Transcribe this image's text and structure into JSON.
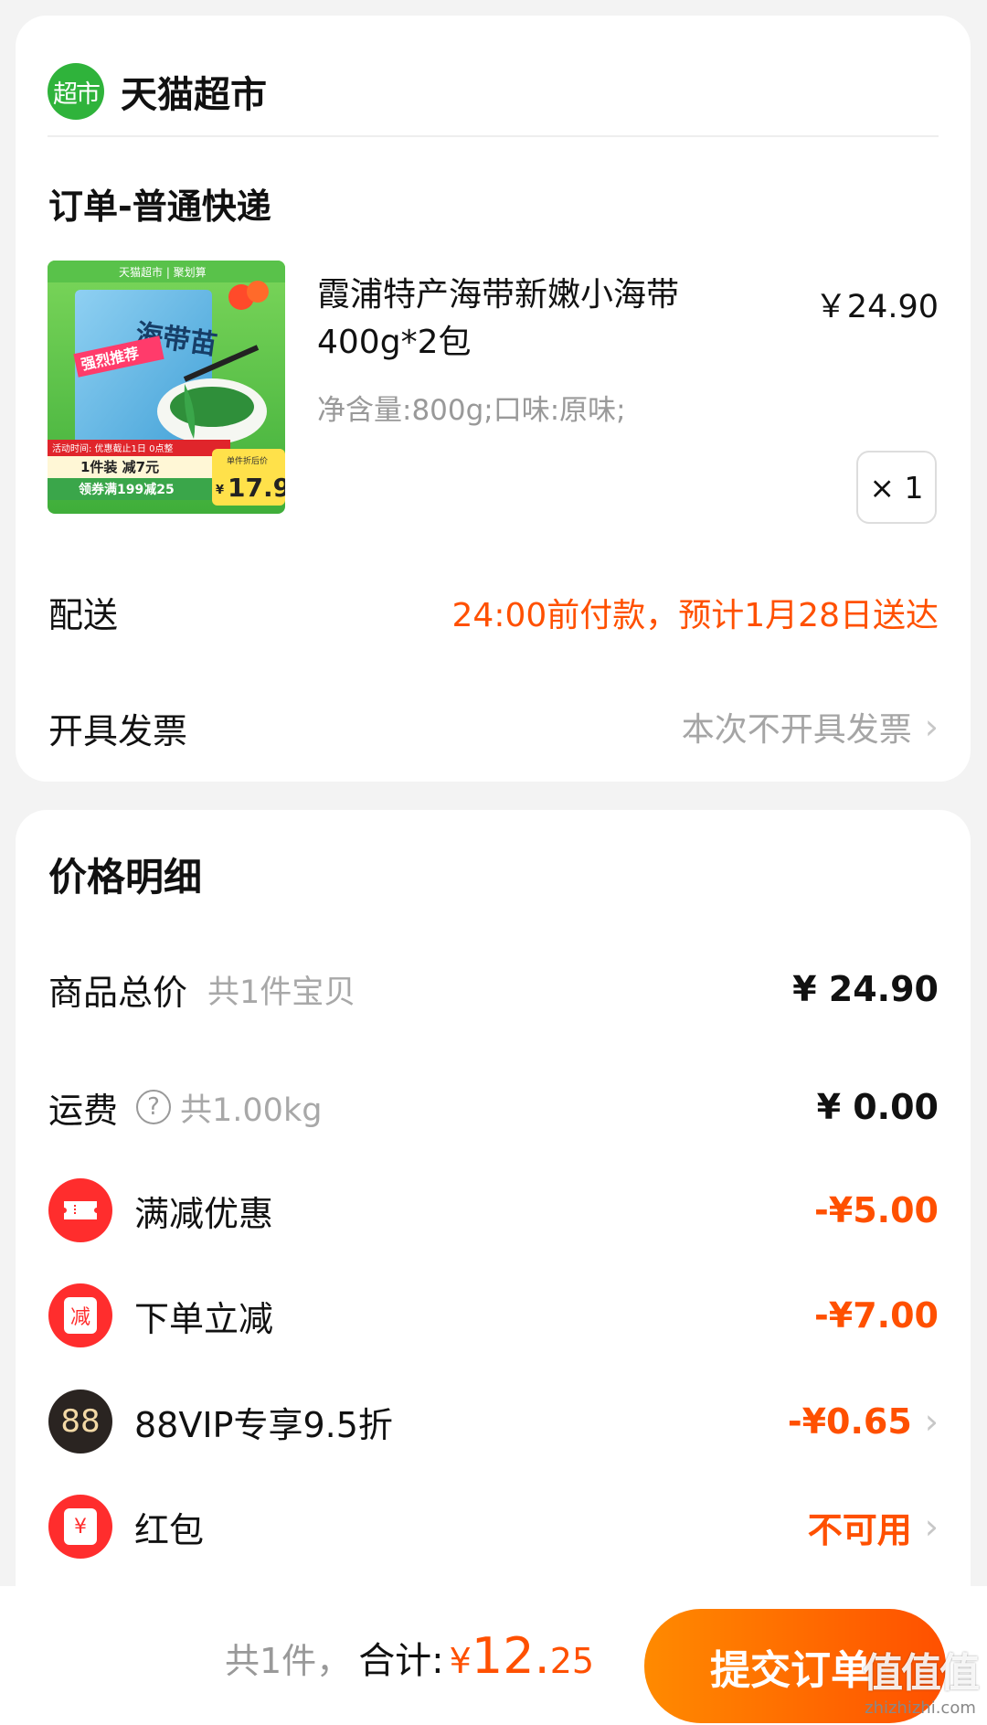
{
  "store": {
    "logo_text": "超市",
    "name": "天猫超市"
  },
  "order": {
    "title": "订单-普通快递",
    "product": {
      "name": "霞浦特产海带新嫩小海带400g*2包",
      "spec": "净含量:800g;口味:原味;",
      "price": "￥24.90",
      "quantity": "× 1",
      "image": {
        "brand_tag": "天猫超市 | 聚划算",
        "title": "海带苗",
        "badge": "强烈推荐",
        "promo_line1": "活动时间: 优惠截止1日 0点整",
        "promo_line2": "1件装 减7元",
        "promo_line3": "领券满199减25",
        "deal_label": "单件折后价",
        "deal_price": "17.9",
        "deal_currency": "¥"
      }
    },
    "delivery": {
      "label": "配送",
      "value": "24:00前付款，预计1月28日送达"
    },
    "invoice": {
      "label": "开具发票",
      "value": "本次不开具发票"
    }
  },
  "price_detail": {
    "title": "价格明细",
    "goods_total": {
      "label": "商品总价",
      "sub": "共1件宝贝",
      "amount": "¥ 24.90"
    },
    "shipping": {
      "label": "运费",
      "sub": "共1.00kg",
      "amount": "¥ 0.00"
    },
    "full_reduction": {
      "label": "满减优惠",
      "amount": "-¥5.00"
    },
    "order_reduction": {
      "label": "下单立减",
      "badge": "减",
      "amount": "-¥7.00"
    },
    "vip": {
      "label": "88VIP专享9.5折",
      "badge": "88",
      "amount": "-¥0.65"
    },
    "red_packet": {
      "label": "红包",
      "badge": "¥",
      "amount": "不可用"
    }
  },
  "footer": {
    "count": "共1件，",
    "total_label": "合计:",
    "currency": "¥",
    "total_int": "12.",
    "total_dec": "25",
    "submit": "提交订单",
    "watermark": "值值值",
    "watermark_url": "zhizhizhi.com"
  },
  "colors": {
    "accent": "#ff5000",
    "store_green": "#2fb33b",
    "badge_red": "#ff2d2d"
  }
}
